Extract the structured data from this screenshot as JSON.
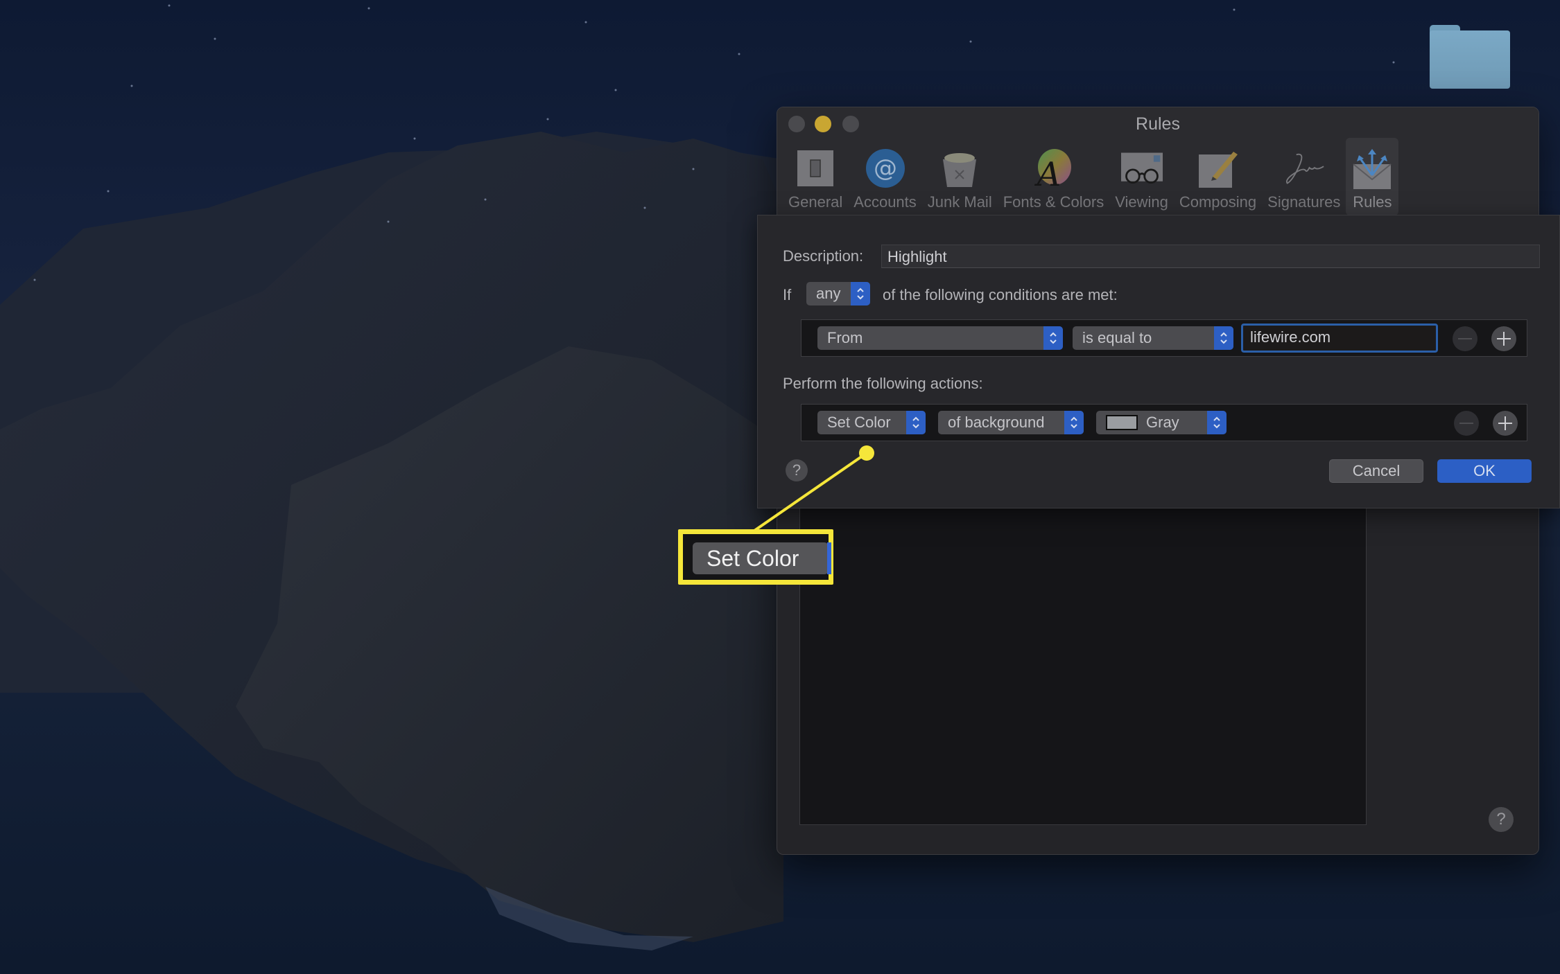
{
  "desktop": {
    "folder_icon": "folder-icon"
  },
  "window": {
    "title": "Rules",
    "traffic_lights": [
      "close",
      "minimize",
      "zoom"
    ],
    "toolbar": [
      {
        "label": "General",
        "icon": "switch-icon",
        "active": false
      },
      {
        "label": "Accounts",
        "icon": "at-sign-icon",
        "active": false
      },
      {
        "label": "Junk Mail",
        "icon": "trash-bin-icon",
        "active": false
      },
      {
        "label": "Fonts & Colors",
        "icon": "color-wheel-font-icon",
        "active": false
      },
      {
        "label": "Viewing",
        "icon": "glasses-envelope-icon",
        "active": false
      },
      {
        "label": "Composing",
        "icon": "pencil-paper-icon",
        "active": false
      },
      {
        "label": "Signatures",
        "icon": "signature-icon",
        "active": false
      },
      {
        "label": "Rules",
        "icon": "envelope-arrows-icon",
        "active": true
      }
    ],
    "help": "?"
  },
  "sheet": {
    "description_label": "Description:",
    "description_value": "Highlight",
    "if_label": "If",
    "match_popup": "any",
    "conditions_label": "of the following conditions are met:",
    "condition": {
      "field": "From",
      "operator": "is equal to",
      "value": "lifewire.com"
    },
    "actions_label": "Perform the following actions:",
    "action": {
      "type": "Set Color",
      "target": "of background",
      "color_name": "Gray",
      "color_swatch": "#9a9da1"
    },
    "help": "?",
    "cancel_label": "Cancel",
    "ok_label": "OK"
  },
  "callout": {
    "label": "Set Color",
    "color": "#f5e63a"
  },
  "colors": {
    "accent_blue": "#2c5fc5",
    "focus_ring": "#2b5fa8",
    "minimize_yellow": "#c9a632"
  }
}
